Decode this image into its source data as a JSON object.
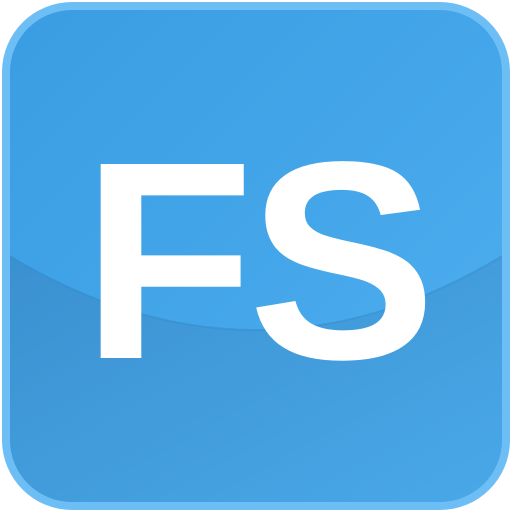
{
  "icon": {
    "text": "FS",
    "colors": {
      "border": "#6BBDF5",
      "fill_top": "#3A9EE3",
      "fill_mid": "#47A9EC",
      "fill_bottom": "#4AAAEB",
      "gloss_shadow": "#3B8FCC",
      "text": "#FFFFFF"
    }
  }
}
